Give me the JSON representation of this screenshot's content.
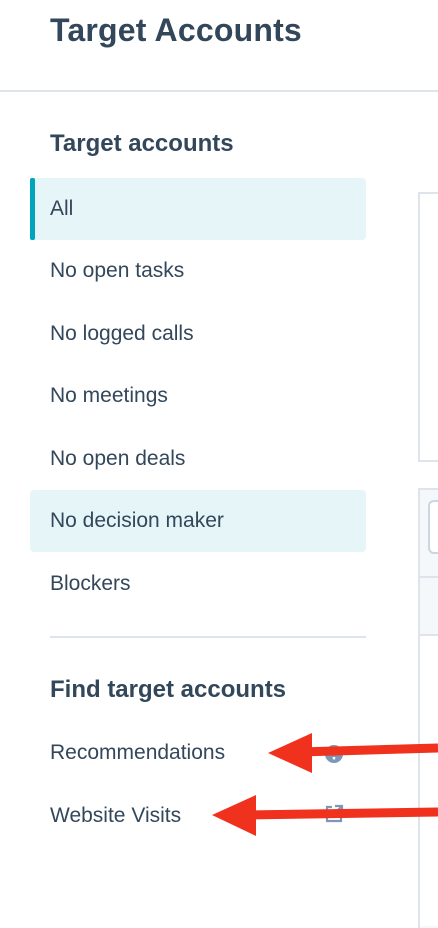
{
  "header": {
    "title": "Target Accounts"
  },
  "sidebar": {
    "target_heading": "Target accounts",
    "views": [
      {
        "label": "All",
        "state": "active"
      },
      {
        "label": "No open tasks",
        "state": "normal"
      },
      {
        "label": "No logged calls",
        "state": "normal"
      },
      {
        "label": "No meetings",
        "state": "normal"
      },
      {
        "label": "No open deals",
        "state": "normal"
      },
      {
        "label": "No decision maker",
        "state": "highlighted"
      },
      {
        "label": "Blockers",
        "state": "normal"
      }
    ],
    "find_heading": "Find target accounts",
    "find_items": [
      {
        "label": "Recommendations",
        "icon": "info-icon"
      },
      {
        "label": "Website Visits",
        "icon": "external-link-icon"
      }
    ]
  },
  "colors": {
    "text": "#33475b",
    "accent": "#00a4bd",
    "active_bg": "#e5f5f8",
    "divider": "#dfe3eb",
    "annotation_arrow": "#f0311e"
  }
}
